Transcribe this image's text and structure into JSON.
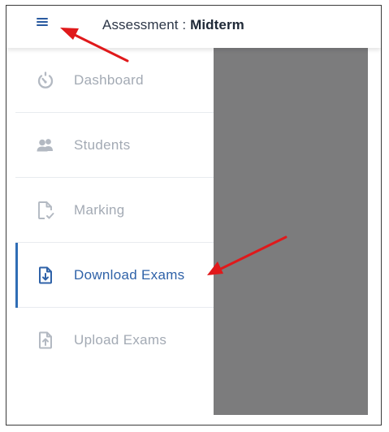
{
  "header": {
    "title_label": "Assessment : ",
    "title_value": "Midterm"
  },
  "sidebar": {
    "items": [
      {
        "label": "Dashboard",
        "icon": "dashboard-icon",
        "active": false
      },
      {
        "label": "Students",
        "icon": "students-icon",
        "active": false
      },
      {
        "label": "Marking",
        "icon": "marking-icon",
        "active": false
      },
      {
        "label": "Download Exams",
        "icon": "download-exams-icon",
        "active": true
      },
      {
        "label": "Upload Exams",
        "icon": "upload-exams-icon",
        "active": false
      }
    ]
  },
  "colors": {
    "accent": "#2f62a8",
    "inactive_text": "#a3aab4",
    "overlay": "#7c7c7d",
    "annotation_arrow": "#e0191b"
  }
}
